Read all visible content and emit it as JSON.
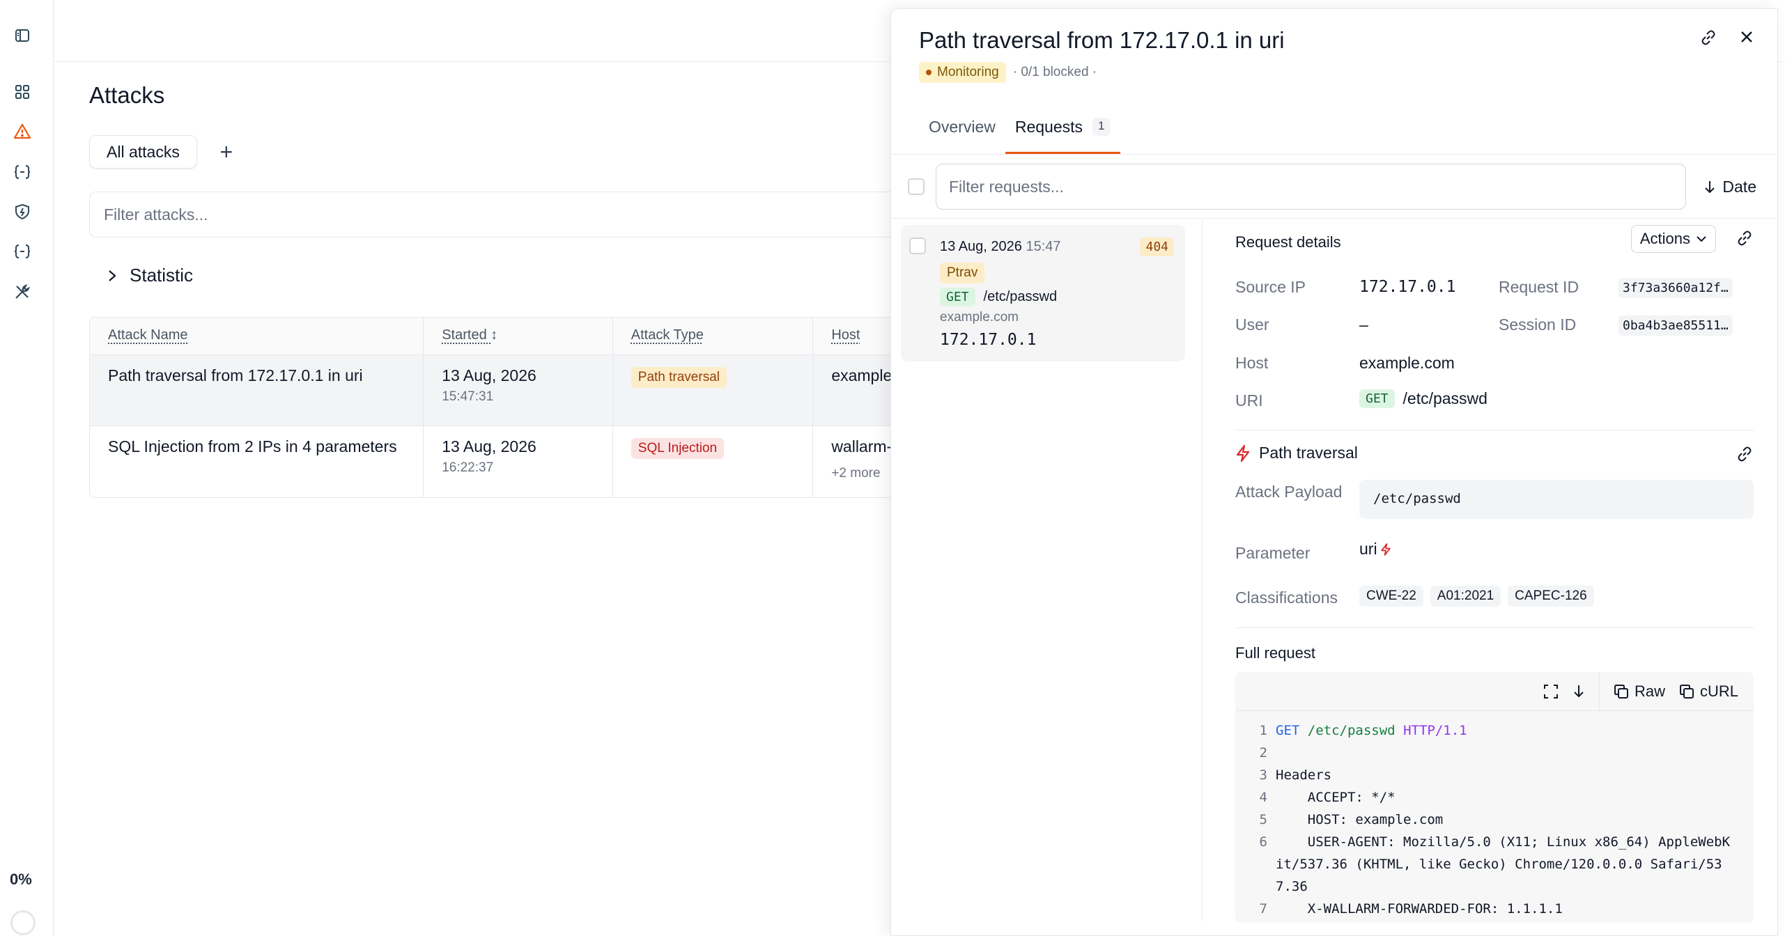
{
  "sidebar": {
    "icons": [
      "panel-toggle-icon",
      "dashboard-icon",
      "alert-triangle-icon",
      "api-braces-icon",
      "shield-icon",
      "api-braces-alt-icon",
      "tools-icon"
    ],
    "progress": "0%"
  },
  "main": {
    "title": "Attacks",
    "tabs": [
      {
        "label": "All attacks"
      }
    ],
    "filter_placeholder": "Filter attacks...",
    "statistic_label": "Statistic",
    "table": {
      "headers": [
        "Attack Name",
        "Started",
        "Attack Type",
        "Host"
      ],
      "rows": [
        {
          "name": "Path traversal from 172.17.0.1 in uri",
          "date": "13 Aug, 2026",
          "time": "15:47:31",
          "type": "Path traversal",
          "host": "example",
          "extra": ""
        },
        {
          "name": "SQL Injection from 2 IPs in 4 parameters",
          "date": "13 Aug, 2026",
          "time": "16:22:37",
          "type": "SQL Injection",
          "host": "wallarm-",
          "extra": "+2 more"
        }
      ]
    }
  },
  "drawer": {
    "title": "Path traversal from 172.17.0.1 in uri",
    "status": "Monitoring",
    "blocked": "· 0/1 blocked ·",
    "tabs": [
      {
        "label": "Overview"
      },
      {
        "label": "Requests",
        "count": "1"
      }
    ],
    "filter_placeholder": "Filter requests...",
    "sort_label": "Date",
    "request_item": {
      "date": "13 Aug, 2026",
      "time": "15:47",
      "status": "404",
      "tag": "Ptrav",
      "method": "GET",
      "uri": "/etc/passwd",
      "host": "example.com",
      "ip": "172.17.0.1"
    },
    "details": {
      "heading": "Request details",
      "actions_label": "Actions",
      "source_ip_label": "Source IP",
      "source_ip": "172.17.0.1",
      "request_id_label": "Request ID",
      "request_id": "3f73a3660a12f…",
      "user_label": "User",
      "user": "–",
      "session_id_label": "Session ID",
      "session_id": "0ba4b3ae85511…",
      "host_label": "Host",
      "host": "example.com",
      "uri_label": "URI",
      "uri_method": "GET",
      "uri": "/etc/passwd",
      "attack_title": "Path traversal",
      "payload_label": "Attack Payload",
      "payload": "/etc/passwd",
      "parameter_label": "Parameter",
      "parameter": "uri",
      "classifications_label": "Classifications",
      "classifications": [
        "CWE-22",
        "A01:2021",
        "CAPEC-126"
      ],
      "full_request_label": "Full request",
      "raw_label": "Raw",
      "curl_label": "cURL",
      "lines": [
        {
          "n": "1",
          "method": "GET",
          "path": "/etc/passwd",
          "ver": "HTTP/1.1"
        },
        {
          "n": "2",
          "text": ""
        },
        {
          "n": "3",
          "text": "Headers"
        },
        {
          "n": "4",
          "text": "    ACCEPT: */*"
        },
        {
          "n": "5",
          "text": "    HOST: example.com"
        },
        {
          "n": "6",
          "text": "    USER-AGENT: Mozilla/5.0 (X11; Linux x86_64) AppleWebKit/537.36 (KHTML, like Gecko) Chrome/120.0.0.0 Safari/537.36"
        },
        {
          "n": "7",
          "text": "    X-WALLARM-FORWARDED-FOR: 1.1.1.1"
        }
      ]
    }
  },
  "colors": {
    "accent": "#ea580c",
    "monitoring_bg": "#fdf1c7",
    "path_traversal_bg": "#fdecc8",
    "sql_bg": "#fde2e2"
  }
}
